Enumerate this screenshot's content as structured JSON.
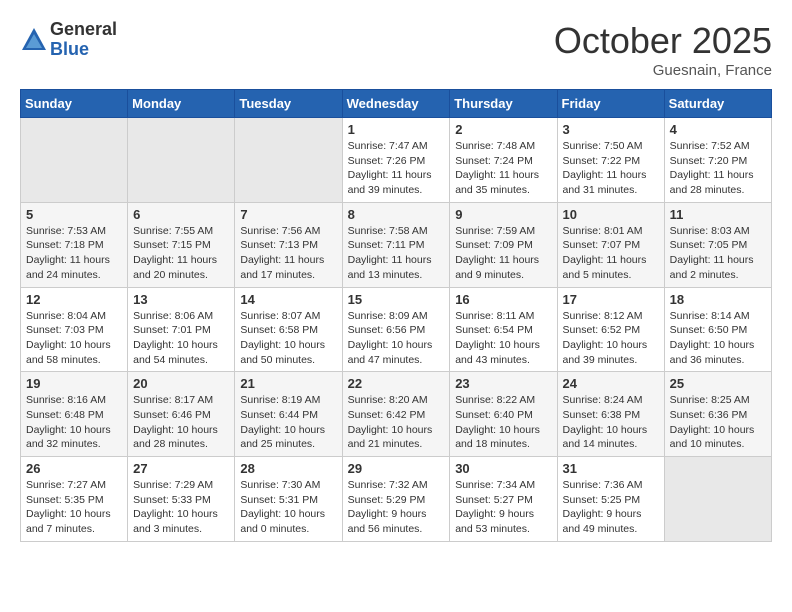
{
  "header": {
    "logo_general": "General",
    "logo_blue": "Blue",
    "month_title": "October 2025",
    "location": "Guesnain, France"
  },
  "weekdays": [
    "Sunday",
    "Monday",
    "Tuesday",
    "Wednesday",
    "Thursday",
    "Friday",
    "Saturday"
  ],
  "weeks": [
    [
      {
        "day": "",
        "info": ""
      },
      {
        "day": "",
        "info": ""
      },
      {
        "day": "",
        "info": ""
      },
      {
        "day": "1",
        "info": "Sunrise: 7:47 AM\nSunset: 7:26 PM\nDaylight: 11 hours\nand 39 minutes."
      },
      {
        "day": "2",
        "info": "Sunrise: 7:48 AM\nSunset: 7:24 PM\nDaylight: 11 hours\nand 35 minutes."
      },
      {
        "day": "3",
        "info": "Sunrise: 7:50 AM\nSunset: 7:22 PM\nDaylight: 11 hours\nand 31 minutes."
      },
      {
        "day": "4",
        "info": "Sunrise: 7:52 AM\nSunset: 7:20 PM\nDaylight: 11 hours\nand 28 minutes."
      }
    ],
    [
      {
        "day": "5",
        "info": "Sunrise: 7:53 AM\nSunset: 7:18 PM\nDaylight: 11 hours\nand 24 minutes."
      },
      {
        "day": "6",
        "info": "Sunrise: 7:55 AM\nSunset: 7:15 PM\nDaylight: 11 hours\nand 20 minutes."
      },
      {
        "day": "7",
        "info": "Sunrise: 7:56 AM\nSunset: 7:13 PM\nDaylight: 11 hours\nand 17 minutes."
      },
      {
        "day": "8",
        "info": "Sunrise: 7:58 AM\nSunset: 7:11 PM\nDaylight: 11 hours\nand 13 minutes."
      },
      {
        "day": "9",
        "info": "Sunrise: 7:59 AM\nSunset: 7:09 PM\nDaylight: 11 hours\nand 9 minutes."
      },
      {
        "day": "10",
        "info": "Sunrise: 8:01 AM\nSunset: 7:07 PM\nDaylight: 11 hours\nand 5 minutes."
      },
      {
        "day": "11",
        "info": "Sunrise: 8:03 AM\nSunset: 7:05 PM\nDaylight: 11 hours\nand 2 minutes."
      }
    ],
    [
      {
        "day": "12",
        "info": "Sunrise: 8:04 AM\nSunset: 7:03 PM\nDaylight: 10 hours\nand 58 minutes."
      },
      {
        "day": "13",
        "info": "Sunrise: 8:06 AM\nSunset: 7:01 PM\nDaylight: 10 hours\nand 54 minutes."
      },
      {
        "day": "14",
        "info": "Sunrise: 8:07 AM\nSunset: 6:58 PM\nDaylight: 10 hours\nand 50 minutes."
      },
      {
        "day": "15",
        "info": "Sunrise: 8:09 AM\nSunset: 6:56 PM\nDaylight: 10 hours\nand 47 minutes."
      },
      {
        "day": "16",
        "info": "Sunrise: 8:11 AM\nSunset: 6:54 PM\nDaylight: 10 hours\nand 43 minutes."
      },
      {
        "day": "17",
        "info": "Sunrise: 8:12 AM\nSunset: 6:52 PM\nDaylight: 10 hours\nand 39 minutes."
      },
      {
        "day": "18",
        "info": "Sunrise: 8:14 AM\nSunset: 6:50 PM\nDaylight: 10 hours\nand 36 minutes."
      }
    ],
    [
      {
        "day": "19",
        "info": "Sunrise: 8:16 AM\nSunset: 6:48 PM\nDaylight: 10 hours\nand 32 minutes."
      },
      {
        "day": "20",
        "info": "Sunrise: 8:17 AM\nSunset: 6:46 PM\nDaylight: 10 hours\nand 28 minutes."
      },
      {
        "day": "21",
        "info": "Sunrise: 8:19 AM\nSunset: 6:44 PM\nDaylight: 10 hours\nand 25 minutes."
      },
      {
        "day": "22",
        "info": "Sunrise: 8:20 AM\nSunset: 6:42 PM\nDaylight: 10 hours\nand 21 minutes."
      },
      {
        "day": "23",
        "info": "Sunrise: 8:22 AM\nSunset: 6:40 PM\nDaylight: 10 hours\nand 18 minutes."
      },
      {
        "day": "24",
        "info": "Sunrise: 8:24 AM\nSunset: 6:38 PM\nDaylight: 10 hours\nand 14 minutes."
      },
      {
        "day": "25",
        "info": "Sunrise: 8:25 AM\nSunset: 6:36 PM\nDaylight: 10 hours\nand 10 minutes."
      }
    ],
    [
      {
        "day": "26",
        "info": "Sunrise: 7:27 AM\nSunset: 5:35 PM\nDaylight: 10 hours\nand 7 minutes."
      },
      {
        "day": "27",
        "info": "Sunrise: 7:29 AM\nSunset: 5:33 PM\nDaylight: 10 hours\nand 3 minutes."
      },
      {
        "day": "28",
        "info": "Sunrise: 7:30 AM\nSunset: 5:31 PM\nDaylight: 10 hours\nand 0 minutes."
      },
      {
        "day": "29",
        "info": "Sunrise: 7:32 AM\nSunset: 5:29 PM\nDaylight: 9 hours\nand 56 minutes."
      },
      {
        "day": "30",
        "info": "Sunrise: 7:34 AM\nSunset: 5:27 PM\nDaylight: 9 hours\nand 53 minutes."
      },
      {
        "day": "31",
        "info": "Sunrise: 7:36 AM\nSunset: 5:25 PM\nDaylight: 9 hours\nand 49 minutes."
      },
      {
        "day": "",
        "info": ""
      }
    ]
  ]
}
